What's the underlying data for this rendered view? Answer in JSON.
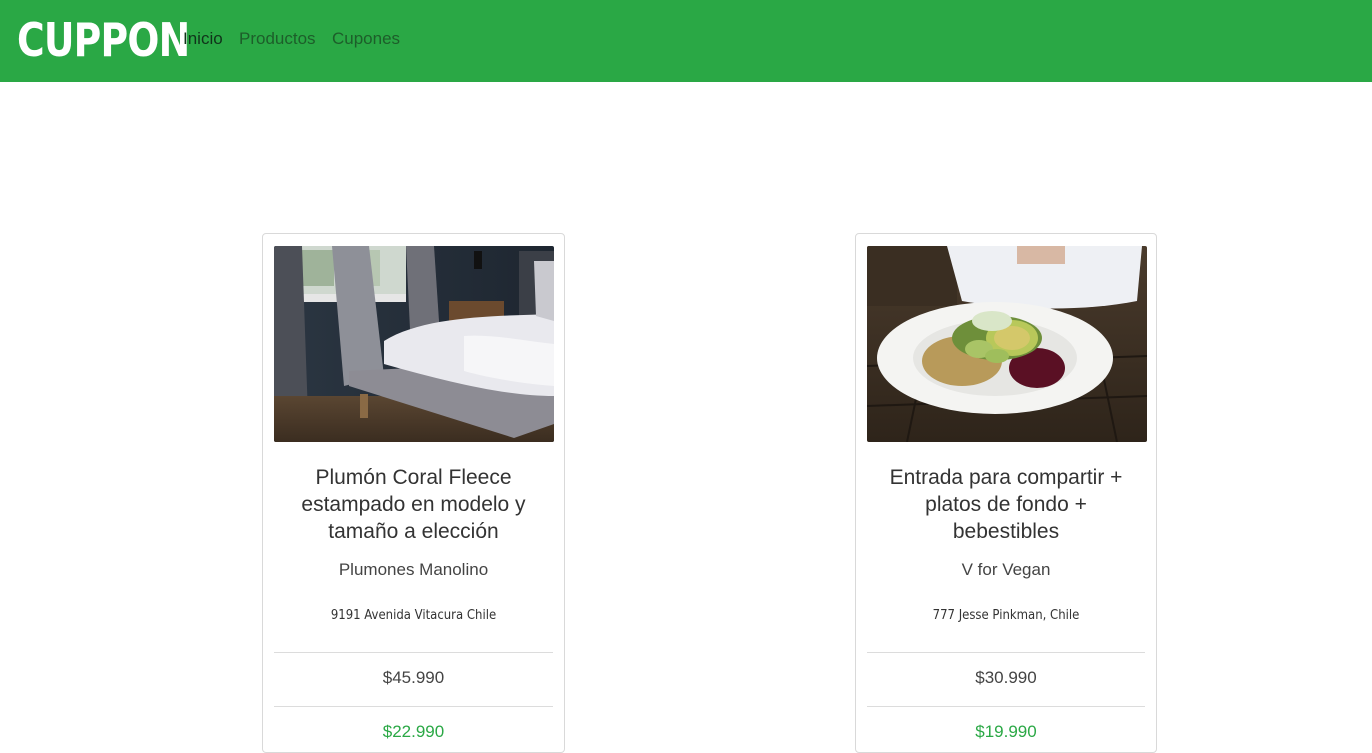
{
  "navbar": {
    "brand": "CUPPON",
    "links": [
      "Inicio",
      "Productos",
      "Cupones"
    ]
  },
  "colors": {
    "navbar_bg": "#2aa845",
    "discount_text": "#2aa845"
  },
  "cards": [
    {
      "image": "bedroom-duvet-photo",
      "title": "Plumón Coral Fleece estampado en modelo y tamaño a elección",
      "vendor": "Plumones Manolino",
      "address": "9191 Avenida Vitacura Chile",
      "price": "$45.990",
      "discount_price": "$22.990"
    },
    {
      "image": "vegan-salad-plate-photo",
      "title": "Entrada para compartir + platos de fondo + bebestibles",
      "vendor": "V for Vegan",
      "address": "777 Jesse Pinkman, Chile",
      "price": "$30.990",
      "discount_price": "$19.990"
    }
  ]
}
